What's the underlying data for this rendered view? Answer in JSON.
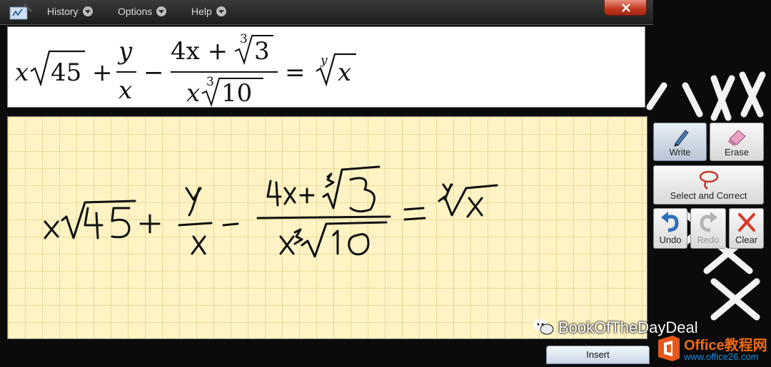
{
  "menu": {
    "history": "History",
    "options": "Options",
    "help": "Help"
  },
  "preview": {
    "t1_x": "x",
    "t1_sqrt_arg": "45",
    "plus": "+",
    "frac1_num": "y",
    "frac1_den": "x",
    "minus": "−",
    "frac2_num_main": "4x + ",
    "frac2_num_root_index": "3",
    "frac2_num_root_arg": "3",
    "frac2_den_x": "x",
    "frac2_den_root_index": "3",
    "frac2_den_root_arg": "10",
    "equals": "=",
    "rhs_root_index": "y",
    "rhs_root_arg": "x"
  },
  "toolbar": {
    "write": "Write",
    "erase": "Erase",
    "select_correct": "Select and Correct",
    "undo": "Undo",
    "redo": "Redo",
    "clear": "Clear"
  },
  "insert": "Insert",
  "watermark": "BookOfTheDayDeal",
  "logo": {
    "brand": "Office教程网",
    "url": "www.office26.com"
  },
  "colors": {
    "pad_background": "#fdf3c4",
    "close_button": "#c2381f",
    "ink": "#111111",
    "brand_orange": "#f06a0f",
    "brand_blue": "#1c8de0"
  }
}
